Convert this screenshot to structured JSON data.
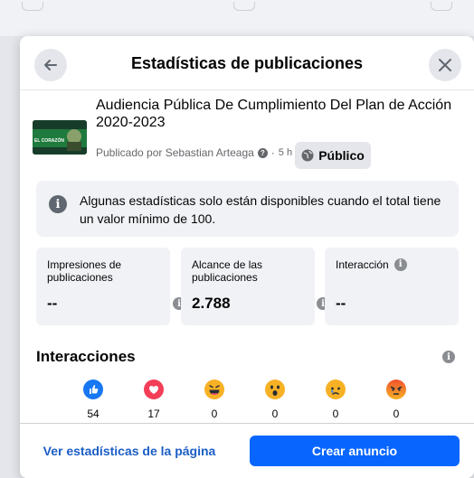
{
  "dialog": {
    "title": "Estadísticas de publicaciones",
    "back_icon": "arrow-left-icon",
    "close_icon": "close-icon"
  },
  "post": {
    "thumbnail_text": "EL CORAZÓN",
    "title": "Audiencia Pública De Cumplimiento Del Plan de Acción 2020-2023",
    "published_by": "Publicado por Sebastian Arteaga",
    "time": "5 h",
    "separator": "·",
    "audience_label": "Público"
  },
  "notice": {
    "text": "Algunas estadísticas solo están disponibles cuando el total tiene un valor mínimo de 100."
  },
  "stats": [
    {
      "label": "Impresiones de publicaciones",
      "value": "--"
    },
    {
      "label": "Alcance de las publicaciones",
      "value": "2.788"
    },
    {
      "label": "Interacción",
      "value": "--"
    }
  ],
  "reactions": {
    "title": "Interacciones",
    "items": [
      {
        "name": "like",
        "count": "54",
        "color": "#1877f2"
      },
      {
        "name": "love",
        "count": "17",
        "color": "#f33e58"
      },
      {
        "name": "haha",
        "count": "0",
        "color": "#f7b125"
      },
      {
        "name": "wow",
        "count": "0",
        "color": "#f7b125"
      },
      {
        "name": "sad",
        "count": "0",
        "color": "#f7b125"
      },
      {
        "name": "angry",
        "count": "0",
        "color": "#e9710f"
      }
    ]
  },
  "footer": {
    "page_stats_label": "Ver estadísticas de la página",
    "create_ad_label": "Crear anuncio"
  },
  "colors": {
    "primary": "#0866ff",
    "link": "#1b5ec6"
  }
}
